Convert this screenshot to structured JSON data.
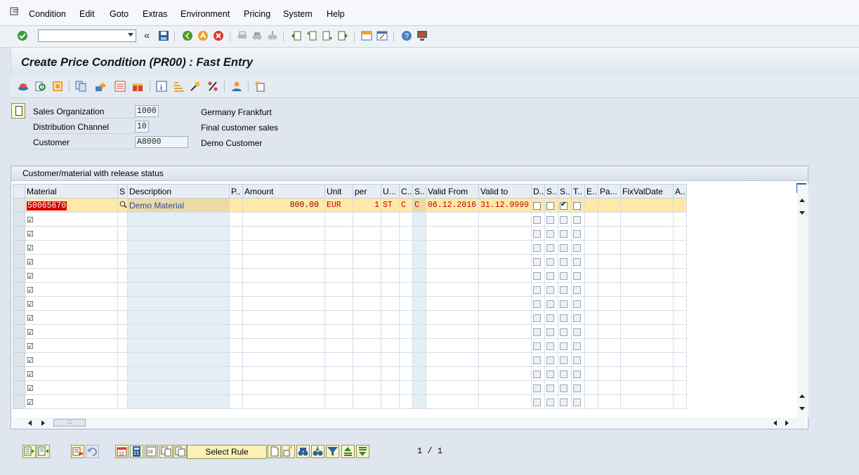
{
  "menu": {
    "items": [
      "Condition",
      "Edit",
      "Goto",
      "Extras",
      "Environment",
      "Pricing",
      "System",
      "Help"
    ]
  },
  "toolbar": {
    "command_field_value": "",
    "icons": [
      "enter-icon",
      "back-arrows-icon",
      "save-icon",
      "back-icon",
      "exit-icon",
      "cancel-icon",
      "print-icon",
      "find-icon",
      "find-next-icon",
      "first-page-icon",
      "previous-page-icon",
      "next-page-icon",
      "last-page-icon",
      "create-session-icon",
      "shortcut-icon",
      "help-icon",
      "customize-layout-icon"
    ]
  },
  "screen": {
    "title": "Create Price Condition (PR00) : Fast Entry"
  },
  "header_fields": [
    {
      "label": "Sales Organization",
      "value": "1000",
      "description": "Germany Frankfurt"
    },
    {
      "label": "Distribution Channel",
      "value": "10",
      "description": "Final customer sales"
    },
    {
      "label": "Customer",
      "value": "A8000",
      "description": "Demo Customer"
    }
  ],
  "grid": {
    "title": "Customer/material with release status",
    "columns": [
      "Material",
      "S",
      "Description",
      "P..",
      "Amount",
      "Unit",
      "per",
      "U...",
      "C..",
      "S..",
      "Valid From",
      "Valid to",
      "D..",
      "S..",
      "S..",
      "T..",
      "E..",
      "Pa...",
      "FixValDate",
      "A.."
    ],
    "first_row": {
      "material": "50065670",
      "description": "Demo Material",
      "amount": "800.00",
      "unit": "EUR",
      "per": "1",
      "uom": "ST",
      "calc_type": "C",
      "scale_type": "C",
      "valid_from": "06.12.2016",
      "valid_to": "31.12.9999",
      "flags": [
        false,
        false,
        true,
        false
      ]
    },
    "empty_rows": 14
  },
  "bottom": {
    "select_rule_label": "Select Rule",
    "pager": "1 / 1"
  }
}
